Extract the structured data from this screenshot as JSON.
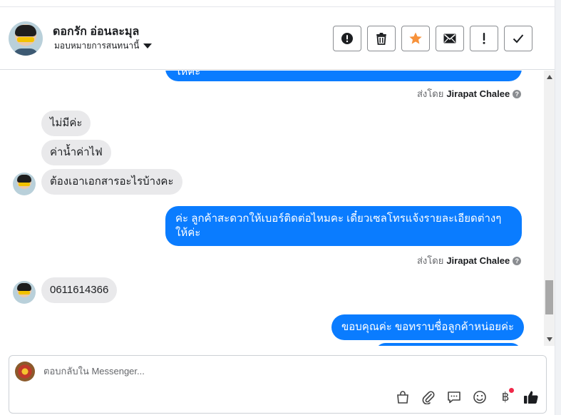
{
  "header": {
    "contact_name": "ดอกรัก อ่อนละมุล",
    "assign_label": "มอบหมายการสนทนานี้"
  },
  "actions": [
    {
      "name": "spam-button",
      "icon": "alert-circle-icon"
    },
    {
      "name": "delete-button",
      "icon": "trash-icon"
    },
    {
      "name": "star-button",
      "icon": "star-icon",
      "color": "#f7923b"
    },
    {
      "name": "mark-unread-button",
      "icon": "envelope-icon"
    },
    {
      "name": "follow-up-button",
      "icon": "exclamation-icon"
    },
    {
      "name": "mark-done-button",
      "icon": "check-icon"
    }
  ],
  "messages": {
    "top_partial": "ให้ค่ะ",
    "sent_by_prefix": "ส่งโดย",
    "agent_name": "Jirapat Chalee",
    "in_1": "ไม่มีค่ะ",
    "in_2": "ค่าน้ำค่าไฟ",
    "in_3": "ต้องเอาเอกสารอะไรบ้างคะ",
    "out_2": "ค่ะ ลูกค้าสะดวกให้เบอร์ติดต่อไหมคะ เดี๋ยวเซลโทรแจ้งรายละเอียดต่างๆ ให้ค่ะ",
    "in_4": "0611614366",
    "out_3": "ขอบคุณค่ะ ขอทราบชื่อลูกค้าหน่อยค่ะ"
  },
  "composer": {
    "placeholder": "ตอบกลับใน Messenger..."
  },
  "colors": {
    "outgoing_bubble": "#0a7cff",
    "incoming_bubble": "#e9e9eb",
    "notification_dot": "#f02849"
  }
}
